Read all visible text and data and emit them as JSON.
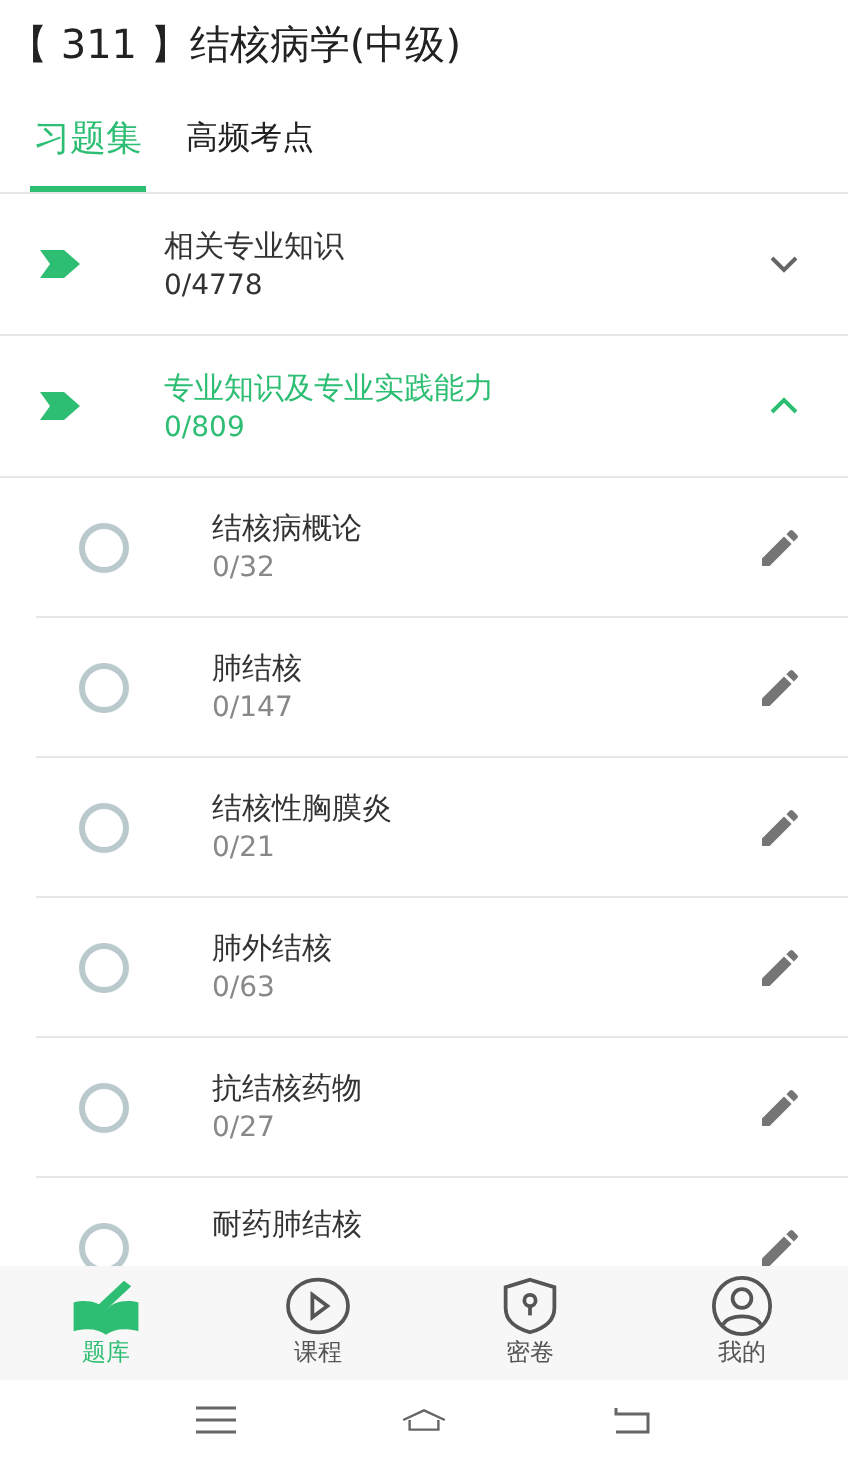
{
  "header": {
    "title": "【 311 】结核病学(中级)"
  },
  "tabs": [
    {
      "label": "习题集",
      "selected": true
    },
    {
      "label": "高频考点",
      "selected": false
    }
  ],
  "sections": [
    {
      "title": "相关专业知识",
      "count": "0/4778",
      "expanded": false
    },
    {
      "title": "专业知识及专业实践能力",
      "count": "0/809",
      "expanded": true,
      "children": [
        {
          "title": "结核病概论",
          "count": "0/32"
        },
        {
          "title": "肺结核",
          "count": "0/147"
        },
        {
          "title": "结核性胸膜炎",
          "count": "0/21"
        },
        {
          "title": "肺外结核",
          "count": "0/63"
        },
        {
          "title": "抗结核药物",
          "count": "0/27"
        },
        {
          "title": "耐药肺结核"
        }
      ]
    }
  ],
  "bottom_nav": [
    {
      "kind": "book",
      "label": "题库",
      "selected": true
    },
    {
      "kind": "play",
      "label": "课程",
      "selected": false
    },
    {
      "kind": "shield",
      "label": "密卷",
      "selected": false
    },
    {
      "kind": "user",
      "label": "我的",
      "selected": false
    }
  ]
}
